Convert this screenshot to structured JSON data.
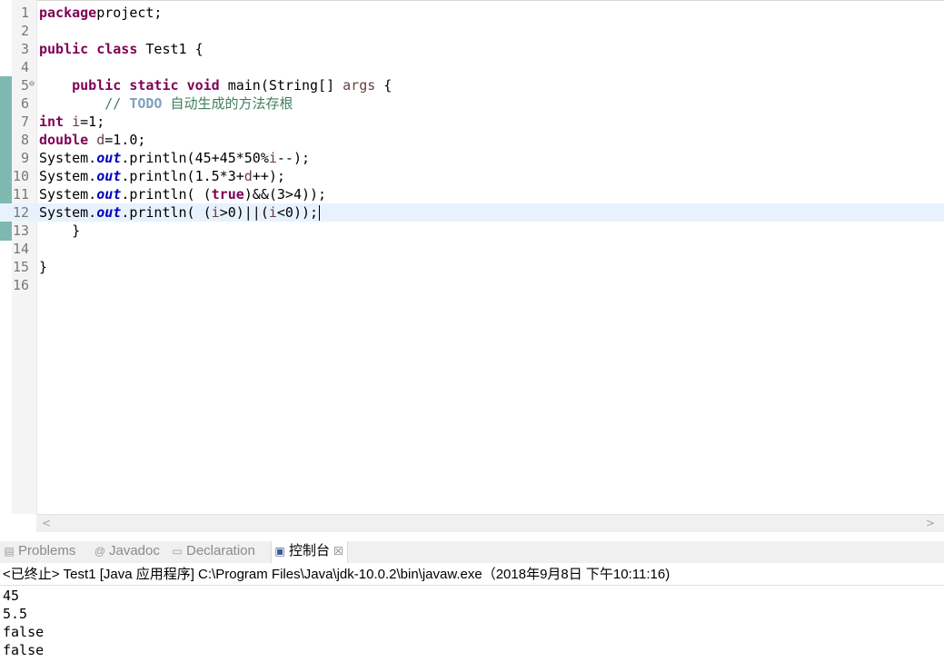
{
  "editor": {
    "lines": [
      {
        "n": "1",
        "parts": [
          [
            "kw",
            "package"
          ],
          [
            "",
            "project;"
          ]
        ]
      },
      {
        "n": "2",
        "parts": []
      },
      {
        "n": "3",
        "parts": [
          [
            "kw",
            "public"
          ],
          [
            "",
            " "
          ],
          [
            "kw",
            "class"
          ],
          [
            "",
            " Test1 {"
          ]
        ]
      },
      {
        "n": "4",
        "parts": []
      },
      {
        "n": "5",
        "fold": "⊖",
        "parts": [
          [
            "",
            "    "
          ],
          [
            "kw",
            "public"
          ],
          [
            "",
            " "
          ],
          [
            "kw",
            "static"
          ],
          [
            "",
            " "
          ],
          [
            "kw",
            "void"
          ],
          [
            "",
            " main(String[] "
          ],
          [
            "var",
            "args"
          ],
          [
            "",
            " {"
          ]
        ]
      },
      {
        "n": "6",
        "parts": [
          [
            "",
            "        "
          ],
          [
            "cm",
            "// "
          ],
          [
            "todo",
            "TODO"
          ],
          [
            "cm",
            " 自动生成的方法存根"
          ]
        ]
      },
      {
        "n": "7",
        "parts": [
          [
            "kw",
            "int"
          ],
          [
            "",
            " "
          ],
          [
            "var",
            "i"
          ],
          [
            "",
            "=1;"
          ]
        ]
      },
      {
        "n": "8",
        "parts": [
          [
            "kw",
            "double"
          ],
          [
            "",
            " "
          ],
          [
            "var",
            "d"
          ],
          [
            "",
            "=1.0;"
          ]
        ]
      },
      {
        "n": "9",
        "parts": [
          [
            "",
            "System."
          ],
          [
            "fld",
            "out"
          ],
          [
            "",
            ".println(45+45*50%"
          ],
          [
            "var",
            "i"
          ],
          [
            "",
            "--);"
          ]
        ]
      },
      {
        "n": "10",
        "parts": [
          [
            "",
            "System."
          ],
          [
            "fld",
            "out"
          ],
          [
            "",
            ".println(1.5*3+"
          ],
          [
            "var",
            "d"
          ],
          [
            "",
            "++);"
          ]
        ]
      },
      {
        "n": "11",
        "parts": [
          [
            "",
            "System."
          ],
          [
            "fld",
            "out"
          ],
          [
            "",
            ".println( ("
          ],
          [
            "kw",
            "true"
          ],
          [
            "",
            ")&&(3>4));"
          ]
        ]
      },
      {
        "n": "12",
        "current": true,
        "caret": true,
        "parts": [
          [
            "",
            "System."
          ],
          [
            "fld",
            "out"
          ],
          [
            "",
            ".println( ("
          ],
          [
            "var",
            "i"
          ],
          [
            "",
            ">0)||("
          ],
          [
            "var",
            "i"
          ],
          [
            "",
            "<0));"
          ]
        ]
      },
      {
        "n": "13",
        "parts": [
          [
            "",
            "    }"
          ]
        ]
      },
      {
        "n": "14",
        "parts": []
      },
      {
        "n": "15",
        "parts": [
          [
            "",
            "}"
          ]
        ]
      },
      {
        "n": "16",
        "parts": []
      }
    ]
  },
  "scroll": {
    "left": "<",
    "right": ">"
  },
  "tabs": {
    "problems": {
      "label": "Problems",
      "icon": "problems-icon"
    },
    "javadoc": {
      "label": "Javadoc",
      "icon": "at-icon"
    },
    "declaration": {
      "label": "Declaration",
      "icon": "declaration-icon"
    },
    "console": {
      "label": "控制台",
      "icon": "console-icon",
      "close": "☒"
    }
  },
  "console": {
    "header": "<已终止> Test1 [Java 应用程序] C:\\Program Files\\Java\\jdk-10.0.2\\bin\\javaw.exe（2018年9月8日 下午10:11:16)",
    "output": [
      "45",
      "5.5",
      "false",
      "false"
    ]
  },
  "colors": {
    "keyword": "#7f0055",
    "field": "#0000c0",
    "local": "#6a3e3e",
    "comment": "#3f7f5f",
    "todo": "#7f9fbf",
    "current_line": "#e8f2fe",
    "change_bar": "#7fb8b0"
  }
}
